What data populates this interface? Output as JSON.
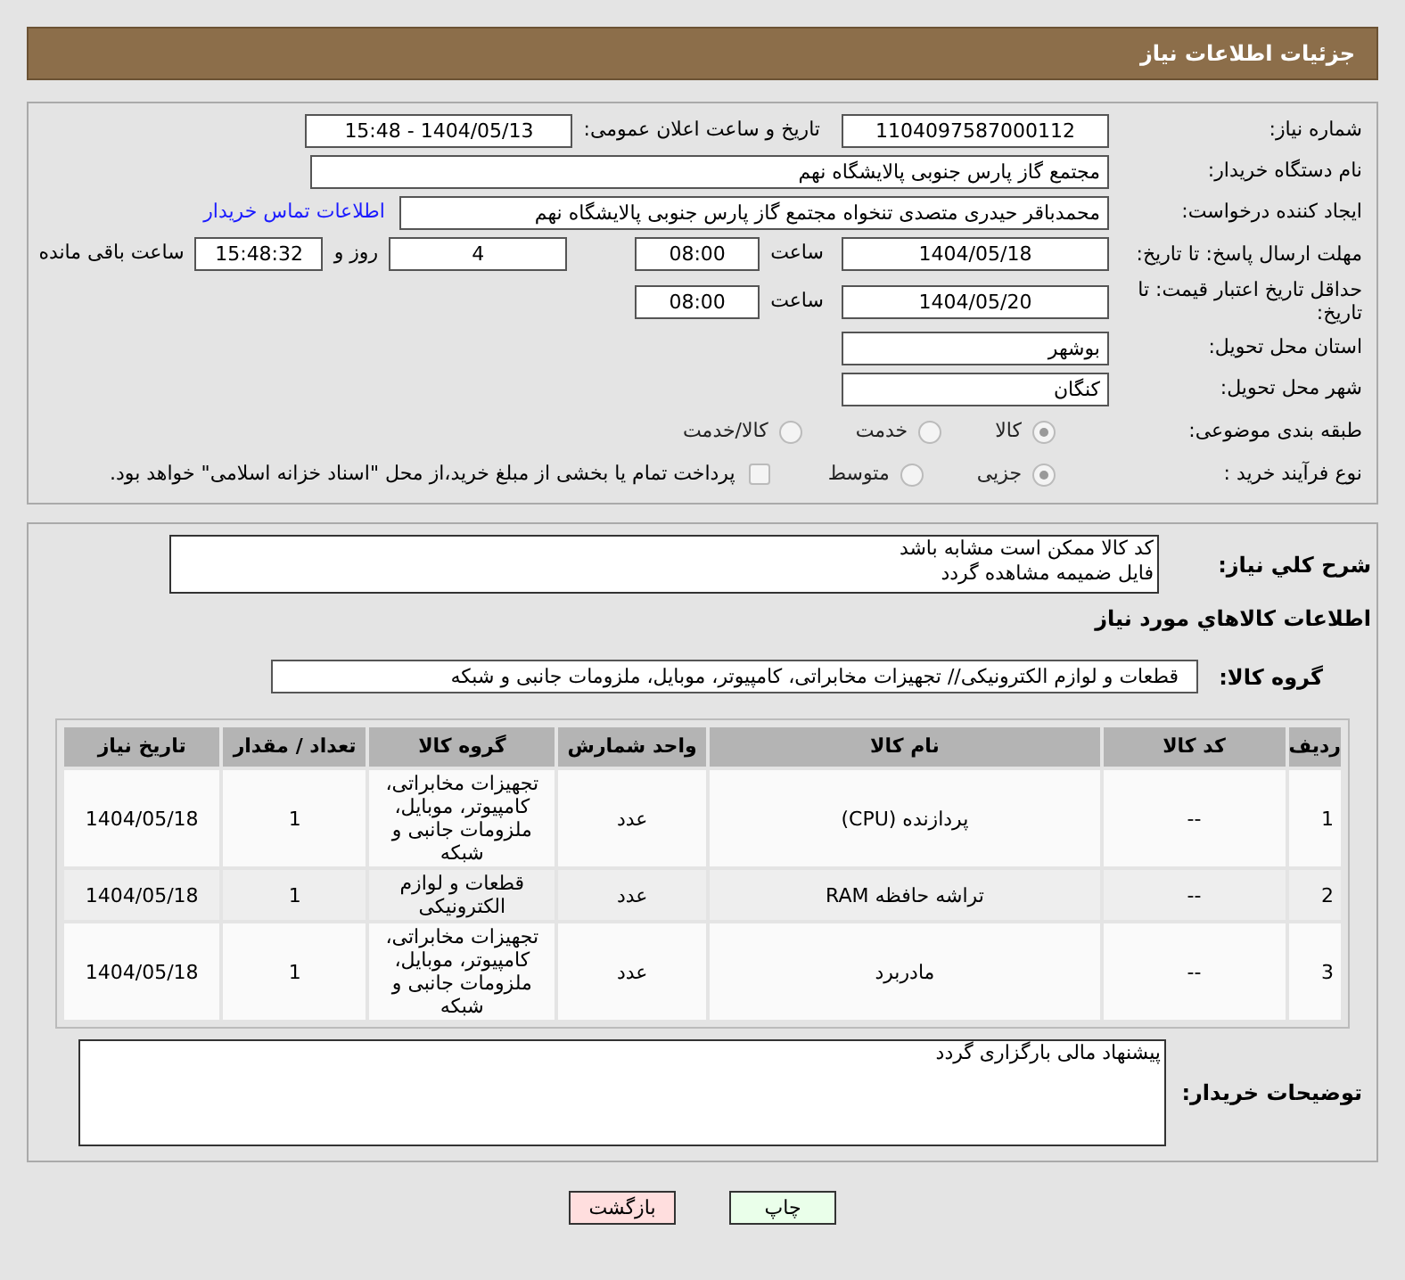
{
  "header": {
    "title": "جزئیات اطلاعات نیاز"
  },
  "need_number": {
    "label": "شماره نیاز:",
    "value": "1104097587000112"
  },
  "announce": {
    "label": "تاریخ و ساعت اعلان عمومی:",
    "value": "1404/05/13 - 15:48"
  },
  "buyer_org": {
    "label": "نام دستگاه خریدار:",
    "value": "مجتمع گاز پارس جنوبی  پالایشگاه نهم"
  },
  "requester": {
    "label": "ایجاد کننده درخواست:",
    "value": "محمدباقر حیدری متصدی تنخواه مجتمع گاز پارس جنوبی  پالایشگاه نهم",
    "link": "اطلاعات تماس خریدار"
  },
  "reply_deadline": {
    "label": "مهلت ارسال پاسخ: تا تاریخ:",
    "date": "1404/05/18",
    "time_label": "ساعت",
    "time": "08:00",
    "days": "4",
    "days_label": "روز و",
    "remaining": "15:48:32",
    "remaining_label": "ساعت باقی مانده"
  },
  "price_validity": {
    "label": "حداقل تاریخ اعتبار قیمت: تا تاریخ:",
    "date": "1404/05/20",
    "time_label": "ساعت",
    "time": "08:00"
  },
  "province": {
    "label": "استان محل تحویل:",
    "value": "بوشهر"
  },
  "city": {
    "label": "شهر محل تحویل:",
    "value": "کنگان"
  },
  "category": {
    "label": "طبقه بندی موضوعی:",
    "options": [
      {
        "label": "کالا",
        "selected": true
      },
      {
        "label": "خدمت",
        "selected": false
      },
      {
        "label": "کالا/خدمت",
        "selected": false
      }
    ]
  },
  "process": {
    "label": "نوع فرآیند خرید :",
    "options": [
      {
        "label": "جزیی",
        "selected": true
      },
      {
        "label": "متوسط",
        "selected": false
      }
    ],
    "payment": {
      "label": "پرداخت تمام یا بخشی از مبلغ خرید،از محل \"اسناد خزانه اسلامی\" خواهد بود.",
      "checked": false
    }
  },
  "description": {
    "label": "شرح کلي نياز:",
    "lines": [
      "کد کالا ممکن است مشابه باشد",
      "فایل ضمیمه مشاهده گردد"
    ]
  },
  "goods_heading": "اطلاعات کالاهاي مورد نياز",
  "goods_group": {
    "label": "گروه کالا:",
    "value": "قطعات و لوازم الکترونیکی// تجهیزات مخابراتی، کامپیوتر، موبایل، ملزومات جانبی و شبکه"
  },
  "table": {
    "columns": [
      "ردیف",
      "کد کالا",
      "نام کالا",
      "واحد شمارش",
      "گروه کالا",
      "تعداد / مقدار",
      "تاریخ نیاز"
    ],
    "rows": [
      [
        "1",
        "--",
        "پردازنده (CPU)",
        "عدد",
        "تجهیزات مخابراتی، کامپیوتر، موبایل، ملزومات جانبی و شبکه",
        "1",
        "1404/05/18"
      ],
      [
        "2",
        "--",
        "تراشه حافظه RAM",
        "عدد",
        "قطعات و لوازم الکترونیکی",
        "1",
        "1404/05/18"
      ],
      [
        "3",
        "--",
        "مادربرد",
        "عدد",
        "تجهیزات مخابراتی، کامپیوتر، موبایل، ملزومات جانبی و شبکه",
        "1",
        "1404/05/18"
      ]
    ]
  },
  "buyer_notes": {
    "label": "توضیحات خریدار:",
    "value": "پیشنهاد مالی بارگزاری گردد"
  },
  "buttons": [
    {
      "label": "چاپ",
      "kind": "print"
    },
    {
      "label": "بازگشت",
      "kind": "back"
    }
  ]
}
